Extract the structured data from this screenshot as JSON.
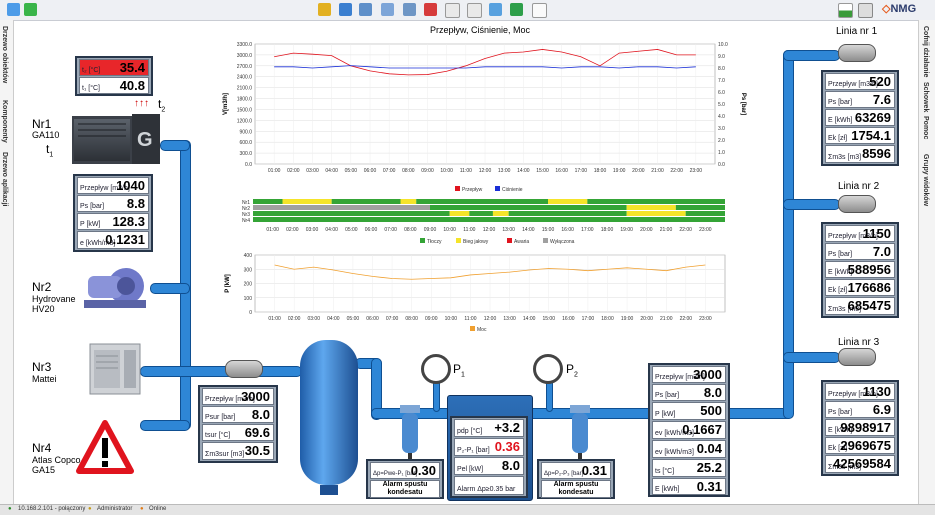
{
  "brand": "NMG",
  "sidebar_left": [
    "Drzewo obiektów",
    "Komponenty",
    "Drzewo aplikacji"
  ],
  "sidebar_right": [
    "Cofnij działanie",
    "Schowek",
    "Pomoc",
    "Grupy widoków"
  ],
  "status": {
    "ip": "10.168.2.101 - połączony",
    "user": "Administrator",
    "mode": "Online"
  },
  "colors": {
    "pipe": "#2e86d6",
    "alarm": "#e8262a",
    "panel": "#9aa7b6"
  },
  "compressors": [
    {
      "name": "Nr1",
      "model": "GA110"
    },
    {
      "name": "Nr2",
      "model": "Hydrovane HV20"
    },
    {
      "name": "Nr3",
      "model": "Mattei"
    },
    {
      "name": "Nr4",
      "model": "Atlas Copco GA15"
    }
  ],
  "temps": [
    {
      "label": "t₂ [°C]",
      "value": "35.4",
      "alarm": true
    },
    {
      "label": "t₁ [°C]",
      "value": "40.8",
      "alarm": false
    }
  ],
  "t_labels": {
    "t1": "t",
    "t1_sub": "1",
    "t2": "t",
    "t2_sub": "2"
  },
  "nr1_panel": [
    {
      "label": "Przepływ [m3/h]",
      "value": "1040"
    },
    {
      "label": "Ps [bar]",
      "value": "8.8"
    },
    {
      "label": "P [kW]",
      "value": "128.3"
    },
    {
      "label": "e [kWh/m3]",
      "value": "0.1231"
    }
  ],
  "collector_panel": [
    {
      "label": "Przepływ [m3/h]",
      "value": "3000"
    },
    {
      "label": "Psur [bar]",
      "value": "8.0"
    },
    {
      "label": "tsur [°C]",
      "value": "69.6"
    },
    {
      "label": "Σm3sur [m3]",
      "value": "30.5"
    }
  ],
  "gauges": {
    "p1": "P",
    "p1_sub": "1",
    "p2": "P",
    "p2_sub": "2"
  },
  "filter_left": {
    "label": "Δp=Pwe-P₁ [bar]",
    "value": "0.30",
    "alarm": "Alarm spustu kondesatu"
  },
  "filter_right": {
    "label": "Δp=P₂-P₃ [bar]",
    "value": "0.31",
    "alarm": "Alarm spustu kondesatu"
  },
  "dryer": [
    {
      "label": "pdp [°C]",
      "value": "+3.2",
      "alarm": false
    },
    {
      "label": "P₂-P₁ [bar]",
      "value": "0.36",
      "alarm": true
    },
    {
      "label": "Pel [kW]",
      "value": "8.0",
      "alarm": false
    },
    {
      "label": "Alarm Δp≥0.35 bar",
      "value": "",
      "alarm": false
    }
  ],
  "output_panel": [
    {
      "label": "Przepływ [m3/h]",
      "value": "3000"
    },
    {
      "label": "Ps [bar]",
      "value": "8.0"
    },
    {
      "label": "P [kW]",
      "value": "500"
    },
    {
      "label": "ev [kWh/m3]",
      "value": "0.1667"
    },
    {
      "label": "ev [kWh/m3]",
      "value": "0.04"
    },
    {
      "label": "ts [°C]",
      "value": "25.2"
    },
    {
      "label": "E [kWh]",
      "value": "0.31"
    }
  ],
  "lines": [
    {
      "name": "Linia nr 1",
      "rows": [
        {
          "label": "Przepływ [m3/h]",
          "value": "520"
        },
        {
          "label": "Ps [bar]",
          "value": "7.6"
        },
        {
          "label": "E [kWh]",
          "value": "63269"
        },
        {
          "label": "Ek [zł]",
          "value": "1754.1"
        },
        {
          "label": "Σm3s [m3]",
          "value": "8596"
        }
      ]
    },
    {
      "name": "Linia nr 2",
      "rows": [
        {
          "label": "Przepływ [m3/h]",
          "value": "1150"
        },
        {
          "label": "Ps [bar]",
          "value": "7.0"
        },
        {
          "label": "E [kWh]",
          "value": "588956"
        },
        {
          "label": "Ek [zł]",
          "value": "176686"
        },
        {
          "label": "Σm3s [m3]",
          "value": "685475"
        }
      ]
    },
    {
      "name": "Linia nr 3",
      "rows": [
        {
          "label": "Przepływ [m3/h]",
          "value": "1130"
        },
        {
          "label": "Ps [bar]",
          "value": "6.9"
        },
        {
          "label": "E [kWh]",
          "value": "9898917"
        },
        {
          "label": "Ek [zł]",
          "value": "2969675"
        },
        {
          "label": "Σm3s [m3]",
          "value": "42569584"
        }
      ]
    }
  ],
  "chart_data": [
    {
      "type": "line",
      "title": "Przepływ, Ciśnienie, Moc",
      "ylabel": "V[m3/h]",
      "y2label": "Ps [bar]",
      "ylim": [
        0,
        3300
      ],
      "y2lim": [
        0,
        10
      ],
      "yticks": [
        "0.0",
        "300.0",
        "600.0",
        "900.0",
        "1200.0",
        "1500.0",
        "1800.0",
        "2100.0",
        "2400.0",
        "2700.0",
        "3000.0",
        "3300.0"
      ],
      "y2ticks": [
        "0.0",
        "1.0",
        "2.0",
        "3.0",
        "4.0",
        "5.0",
        "6.0",
        "7.0",
        "8.0",
        "9.0",
        "10.0"
      ],
      "x": [
        "01:00",
        "02:00",
        "03:00",
        "04:00",
        "05:00",
        "06:00",
        "07:00",
        "08:00",
        "09:00",
        "10:00",
        "11:00",
        "12:00",
        "13:00",
        "14:00",
        "15:00",
        "16:00",
        "17:00",
        "18:00",
        "19:00",
        "20:00",
        "21:00",
        "22:00",
        "23:00"
      ],
      "series": [
        {
          "name": "Przepływ",
          "color": "#e0141e",
          "axis": "left",
          "values": [
            2950,
            3050,
            3020,
            2980,
            2700,
            2560,
            2480,
            2450,
            2460,
            2550,
            2700,
            2900,
            3050,
            3080,
            3150,
            3080,
            2950,
            2700,
            3050,
            3100,
            3150,
            3000,
            3000
          ]
        },
        {
          "name": "Ciśnienie",
          "color": "#1a2fd6",
          "axis": "right",
          "values": [
            8.1,
            8.1,
            8.0,
            8.1,
            8.2,
            8.1,
            8.0,
            8.0,
            8.0,
            8.0,
            8.0,
            8.1,
            8.1,
            8.1,
            8.1,
            8.0,
            8.1,
            8.1,
            8.0,
            8.1,
            8.1,
            8.0,
            8.1
          ]
        }
      ]
    },
    {
      "type": "timeline",
      "rows": [
        "Nr1",
        "Nr2",
        "Nr3",
        "Nr4"
      ],
      "x": [
        "01:00",
        "02:00",
        "03:00",
        "04:00",
        "05:00",
        "06:00",
        "07:00",
        "08:00",
        "09:00",
        "10:00",
        "11:00",
        "12:00",
        "13:00",
        "14:00",
        "15:00",
        "16:00",
        "17:00",
        "18:00",
        "19:00",
        "20:00",
        "21:00",
        "22:00",
        "23:00"
      ],
      "legend": [
        {
          "name": "Tłoczy",
          "color": "#34a436"
        },
        {
          "name": "Bieg jałowy",
          "color": "#f5e42a"
        },
        {
          "name": "Awaria",
          "color": "#e0141e"
        },
        {
          "name": "Wyłączona",
          "color": "#a0a0a0"
        }
      ],
      "segments": [
        [
          [
            "Tłoczy",
            0,
            1.5
          ],
          [
            "Bieg jałowy",
            1.5,
            4
          ],
          [
            "Tłoczy",
            4,
            7.5
          ],
          [
            "Bieg jałowy",
            7.5,
            8.3
          ],
          [
            "Tłoczy",
            8.3,
            15
          ],
          [
            "Bieg jałowy",
            15,
            17
          ],
          [
            "Tłoczy",
            17,
            24
          ]
        ],
        [
          [
            "Wyłączona",
            0,
            9
          ],
          [
            "Tłoczy",
            9,
            19
          ],
          [
            "Bieg jałowy",
            19,
            21.5
          ],
          [
            "Tłoczy",
            21.5,
            24
          ]
        ],
        [
          [
            "Tłoczy",
            0,
            10
          ],
          [
            "Bieg jałowy",
            10,
            11
          ],
          [
            "Tłoczy",
            11,
            12.2
          ],
          [
            "Bieg jałowy",
            12.2,
            13
          ],
          [
            "Tłoczy",
            13,
            19
          ],
          [
            "Bieg jałowy",
            19,
            22
          ],
          [
            "Tłoczy",
            22,
            24
          ]
        ],
        [
          [
            "Tłoczy",
            0,
            24
          ]
        ]
      ]
    },
    {
      "type": "line",
      "ylabel": "P [kW]",
      "ylim": [
        0,
        400
      ],
      "yticks": [
        "0",
        "100",
        "200",
        "300",
        "400"
      ],
      "x": [
        "01:00",
        "02:00",
        "03:00",
        "04:00",
        "05:00",
        "06:00",
        "07:00",
        "08:00",
        "09:00",
        "10:00",
        "11:00",
        "12:00",
        "13:00",
        "14:00",
        "15:00",
        "16:00",
        "17:00",
        "18:00",
        "19:00",
        "20:00",
        "21:00",
        "22:00",
        "23:00"
      ],
      "series": [
        {
          "name": "Moc",
          "color": "#f0a030",
          "values": [
            330,
            300,
            315,
            295,
            270,
            250,
            235,
            230,
            235,
            240,
            260,
            270,
            280,
            295,
            305,
            300,
            290,
            300,
            310,
            300,
            290,
            315,
            330
          ]
        }
      ]
    }
  ]
}
